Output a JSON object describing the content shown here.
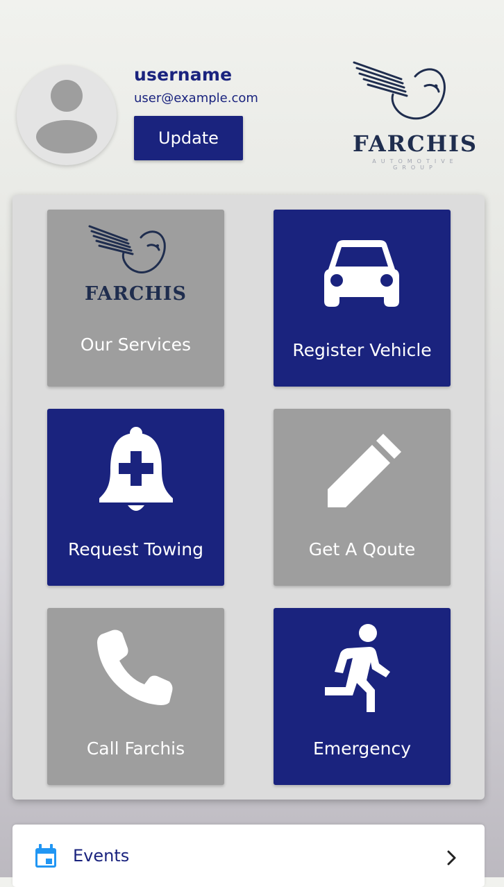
{
  "profile": {
    "username": "username",
    "email": "user@example.com",
    "update_label": "Update",
    "avatar_icon": "person-placeholder-icon"
  },
  "brand": {
    "name": "FARCHIS",
    "tagline": "AUTOMOTIVE GROUP",
    "icon": "eagle-logo"
  },
  "tiles": [
    {
      "label": "Our Services",
      "icon": "farchis-logo",
      "color": "#9e9e9e"
    },
    {
      "label": "Register Vehicle",
      "icon": "car-icon",
      "color": "#1a237e"
    },
    {
      "label": "Request Towing",
      "icon": "bell-plus-icon",
      "color": "#1a237e"
    },
    {
      "label": "Get A Qoute",
      "icon": "pencil-icon",
      "color": "#9e9e9e"
    },
    {
      "label": "Call Farchis",
      "icon": "phone-icon",
      "color": "#9e9e9e"
    },
    {
      "label": "Emergency",
      "icon": "running-person-icon",
      "color": "#1a237e"
    }
  ],
  "events": {
    "label": "Events",
    "icon": "calendar-icon",
    "chevron": "chevron-right-icon"
  },
  "colors": {
    "primary": "#1a237e",
    "tile_gray": "#9e9e9e",
    "panel": "#dcdcdc",
    "icon_blue": "#2196f3"
  }
}
